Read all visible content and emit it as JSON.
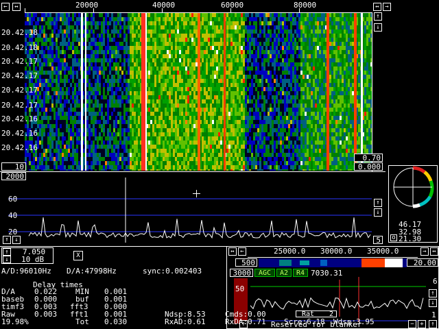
{
  "top_ruler": {
    "labels": [
      "20000",
      "40000",
      "60000",
      "80000"
    ]
  },
  "waterfall": {
    "timestamps": [
      "20.42.18",
      "20.42.18",
      "20.42.17",
      "20.42.17",
      "20.42.17",
      "20.42.17",
      "20.42.16",
      "20.42.16",
      "20.42.16"
    ],
    "bottom_left_value": "10",
    "right_values": [
      "0.70",
      "0.000"
    ]
  },
  "spectrum": {
    "top_left_value": "2000",
    "axis_labels": [
      "60",
      "40",
      "20"
    ],
    "right_value": "5"
  },
  "controls": {
    "row1_value": "7.050",
    "row2_value": "10 dB",
    "x_button": "X"
  },
  "info": {
    "ad": "A/D:96010Hz",
    "da": "D/A:47998Hz",
    "sync": "sync:0.002403",
    "delay_title": "Delay times",
    "rows": [
      [
        "D/A",
        "0.022",
        "MIN",
        "0.001"
      ],
      [
        "baseb",
        "0.000",
        "buf",
        "0.001"
      ],
      [
        "timf3",
        "0.003",
        "fft3",
        "0.000"
      ],
      [
        "Raw",
        "0.003",
        "fft1",
        "0.001"
      ],
      [
        "19.98%",
        "",
        "Tot",
        "0.030"
      ]
    ],
    "ndsp": "Ndsp:8.53",
    "rxad": "RxAD:0.61",
    "cmds": "Cmds:0.00",
    "rxda": "RxDA:0.71",
    "scre": "Scre:6.18",
    "wdsp": "Wdsp:3.95"
  },
  "sidebar": {
    "values": [
      "46.17",
      "32.98",
      "21.30"
    ],
    "o_label": "o"
  },
  "baseband": {
    "ruler_labels": [
      "25000.0",
      "30000.0",
      "35000.0"
    ],
    "left_value": "500",
    "right_value": "20.00",
    "bw_value": "3000",
    "agc": "AGC",
    "a2": "A2",
    "r4": "R4",
    "freq": "7030.31",
    "level": "50",
    "right_level": "6",
    "right_bottom": "1",
    "rat": "Rat",
    "rat_num": "2",
    "reserved": "Reserved for blanker"
  },
  "colors": {
    "accent_blue": "#0000a8",
    "spectrum_grid": "#2a36ff",
    "green_line": "#00cc00"
  }
}
